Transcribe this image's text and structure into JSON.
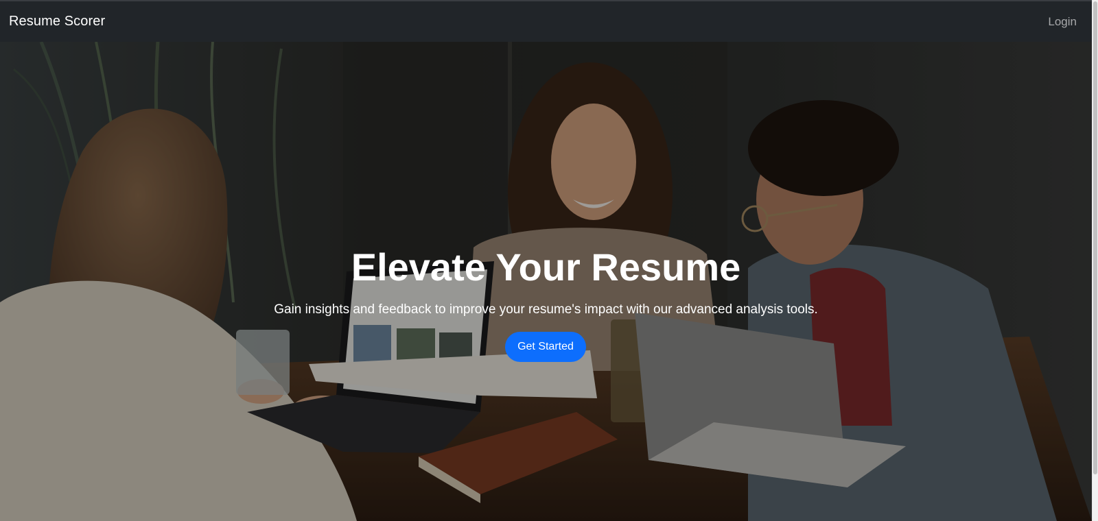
{
  "navbar": {
    "brand": "Resume Scorer",
    "login_label": "Login"
  },
  "hero": {
    "title": "Elevate Your Resume",
    "subtitle": "Gain insights and feedback to improve your resume's impact with our advanced analysis tools.",
    "cta_label": "Get Started",
    "background_image": "team-meeting-photo"
  },
  "colors": {
    "navbar_bg": "#212529",
    "primary": "#0d6efd",
    "text_light": "#ffffff"
  }
}
